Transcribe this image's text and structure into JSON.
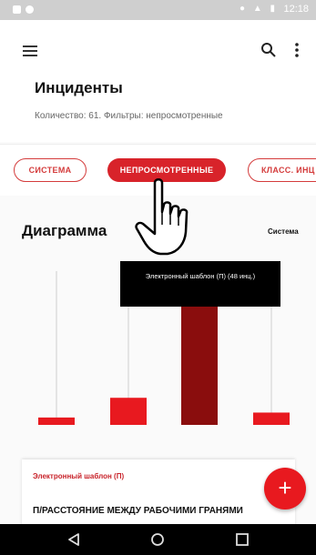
{
  "status": {
    "time": "12:18"
  },
  "header": {
    "title": "Инциденты",
    "subtitle": "Количество: 61. Фильтры: непросмотренные"
  },
  "chips": [
    {
      "label": "СИСТЕМА",
      "selected": false
    },
    {
      "label": "НЕПРОСМОТРЕННЫЕ",
      "selected": true
    },
    {
      "label": "КЛАСС. ИНЦ",
      "selected": false
    }
  ],
  "diagram": {
    "title": "Диаграмма",
    "group_label": "Система",
    "tooltip": "Электронный шаблон (П) (48 инц.)"
  },
  "chart_data": {
    "type": "bar",
    "values": [
      3,
      11,
      48,
      5
    ],
    "selected_index": 2,
    "colors": {
      "bar": "#e8191f",
      "selected": "#8a0d0d"
    }
  },
  "card": {
    "title": "Электронный шаблон (П)",
    "body": "П/РАССТОЯНИЕ МЕЖДУ РАБОЧИМИ ГРАНЯМИ"
  },
  "fab": {
    "icon": "plus-icon",
    "label": "+"
  },
  "icons": {
    "menu": "menu-icon",
    "search": "search-icon",
    "more": "more-vert-icon",
    "back": "nav-back-icon",
    "home": "nav-home-icon",
    "recents": "nav-recents-icon",
    "cursor": "hand-pointer-icon"
  },
  "colors": {
    "accent": "#d8232a",
    "selected_bar": "#8a0d0d"
  }
}
